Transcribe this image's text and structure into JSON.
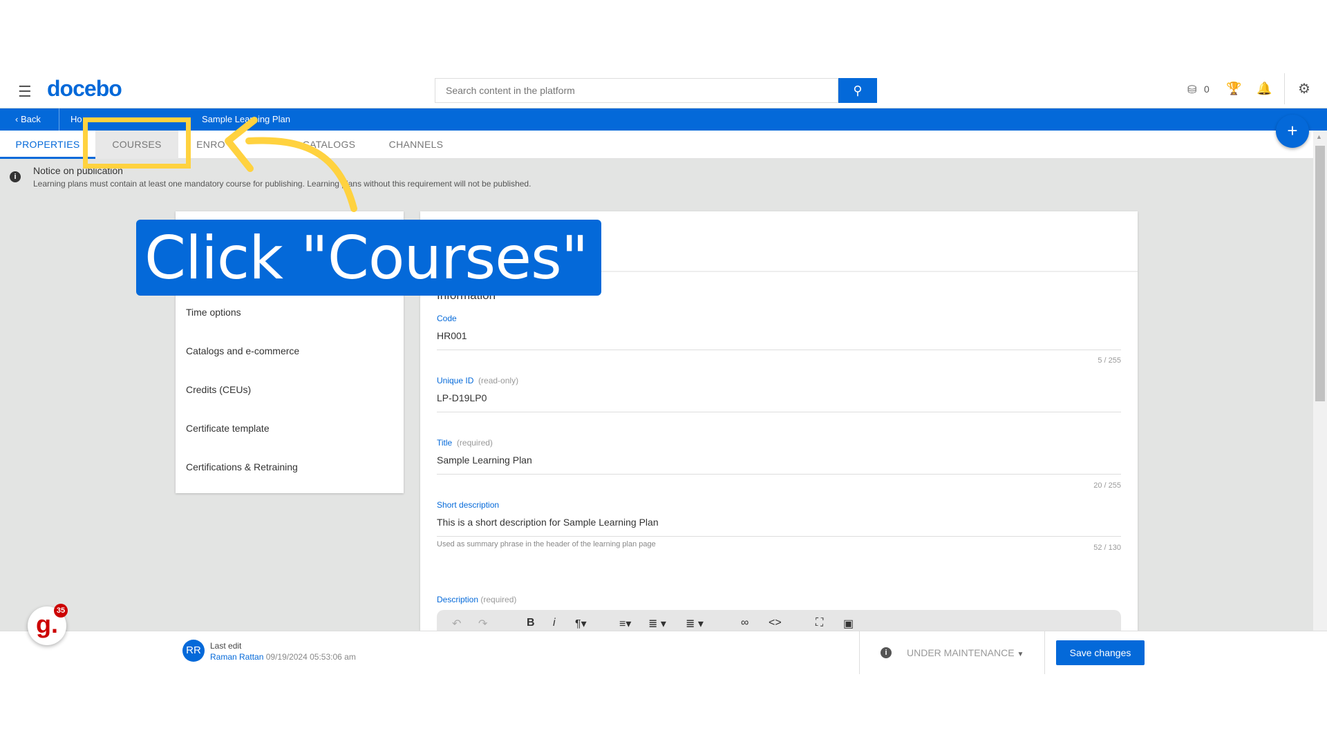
{
  "header": {
    "logo": "docebo",
    "search_placeholder": "Search content in the platform",
    "coins": "0"
  },
  "breadcrumb": {
    "back": "Back",
    "home": "Ho",
    "current": "Sample Learning Plan"
  },
  "tabs": [
    {
      "label": "PROPERTIES",
      "active": true
    },
    {
      "label": "COURSES"
    },
    {
      "label": "ENRO"
    },
    {
      "label": "CATALOGS"
    },
    {
      "label": "CHANNELS"
    }
  ],
  "notice": {
    "title": "Notice on publication",
    "text": "Learning plans must contain at least one mandatory course for publishing. Learning plans without this requirement will not be published."
  },
  "left_panel": {
    "items": [
      "Time options",
      "Catalogs and e-commerce",
      "Credits (CEUs)",
      "Certificate template",
      "Certifications & Retraining"
    ]
  },
  "form": {
    "section": "Information",
    "code": {
      "label": "Code",
      "value": "HR001",
      "count": "5 / 255"
    },
    "unique_id": {
      "label": "Unique ID",
      "hint": "(read-only)",
      "value": "LP-D19LP0"
    },
    "title": {
      "label": "Title",
      "hint": "(required)",
      "value": "Sample Learning Plan",
      "count": "20 / 255"
    },
    "short_description": {
      "label": "Short description",
      "value": "This is a short description for Sample Learning Plan",
      "helper": "Used as summary phrase in the header of the learning plan page",
      "count": "52 / 130"
    },
    "description": {
      "label": "Description",
      "hint": "(required)"
    }
  },
  "footer": {
    "avatar": "RR",
    "last_edit": "Last edit",
    "user": "Raman Rattan",
    "date": "09/19/2024 05:53:06 am",
    "status": "UNDER MAINTENANCE",
    "save": "Save changes"
  },
  "overlay": {
    "instruction": "Click \"Courses\"",
    "badge": "35",
    "badge_letter": "g."
  },
  "colors": {
    "brand": "#0469d9",
    "highlight": "#ffd23f",
    "background": "#e3e4e3"
  }
}
